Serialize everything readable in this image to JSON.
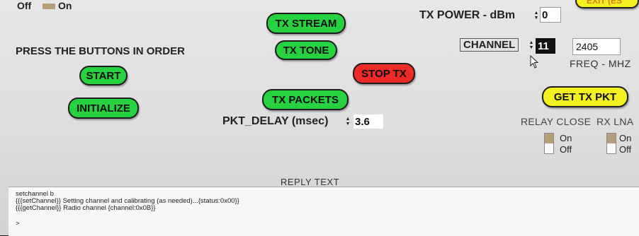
{
  "toggles_top": {
    "off_label": "Off",
    "on_label": "On"
  },
  "buttons": {
    "tx_stream": "TX STREAM",
    "tx_tone": "TX TONE",
    "stop_tx": "STOP TX",
    "tx_packets": "TX PACKETS",
    "start": "START",
    "initialize": "INITIALIZE",
    "get_tx_pkt": "GET TX PKT",
    "exit": "EXIT (ES"
  },
  "instructions": "PRESS THE BUTTONS IN ORDER",
  "tx_power": {
    "label": "TX POWER - dBm",
    "value": "0"
  },
  "channel": {
    "label": "CHANNEL",
    "value": "11"
  },
  "freq": {
    "value": "2405",
    "label": "FREQ - MHZ"
  },
  "pkt_delay": {
    "label": "PKT_DELAY (msec)",
    "value": "3.6"
  },
  "relay_close": {
    "label": "RELAY CLOSE",
    "on_label": "On",
    "off_label": "Off",
    "state": "On"
  },
  "rx_lna": {
    "label": "RX LNA",
    "on_label": "On",
    "off_label": "Off",
    "state": "On"
  },
  "reply": {
    "title": "REPLY TEXT",
    "lines": [
      "setchannel b",
      "{{{setChannel}} Setting channel and calibrating (as needed)...{status:0x00}}",
      "{{{getChannel}} Radio channel {channel:0x0B}}",
      ">"
    ]
  },
  "colors": {
    "green": "#26d23f",
    "red": "#ee2a28",
    "yellow": "#f4ef1f",
    "panel": "#e0e0e0"
  }
}
